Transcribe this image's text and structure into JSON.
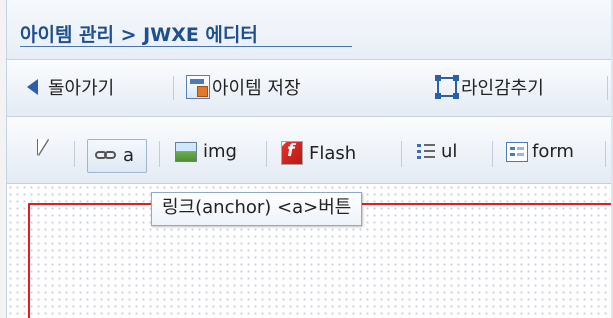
{
  "title": {
    "text": "아이템 관리 > JWXE 에디터"
  },
  "toolbar1": {
    "back_label": "돌아가기",
    "save_label": "아이템 저장",
    "hide_lines_label": "라인감추기"
  },
  "toolbar2": {
    "anchor_label": "a",
    "img_label": "img",
    "flash_label": "Flash",
    "ul_label": "ul",
    "form_label": "form"
  },
  "tooltip": {
    "text": "링크(anchor) <a>버튼"
  },
  "colors": {
    "title": "#1f4f8f",
    "accent": "#2a5fab",
    "frame": "#e02020"
  },
  "icons": {
    "back": "back-arrow-icon",
    "save": "save-icon",
    "hide_lines": "hide-lines-icon",
    "select": "cursor-icon",
    "anchor": "link-icon",
    "img": "image-icon",
    "flash": "flash-icon",
    "ul": "list-icon",
    "form": "form-icon"
  }
}
